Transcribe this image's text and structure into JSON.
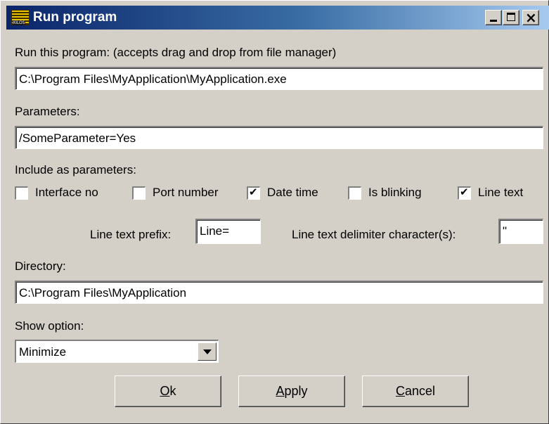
{
  "window": {
    "title": "Run program"
  },
  "run_program": {
    "label": "Run this program: (accepts drag and drop from file manager)",
    "value": "C:\\Program Files\\MyApplication\\MyApplication.exe"
  },
  "parameters": {
    "label": "Parameters:",
    "value": "/SomeParameter=Yes"
  },
  "include": {
    "label": "Include as parameters:",
    "options": [
      {
        "label": "Interface no",
        "checked": false
      },
      {
        "label": "Port number",
        "checked": false
      },
      {
        "label": "Date time",
        "checked": true
      },
      {
        "label": "Is blinking",
        "checked": false
      },
      {
        "label": "Line text",
        "checked": true
      }
    ]
  },
  "line_text": {
    "prefix_label": "Line text prefix:",
    "prefix_value": "Line=",
    "delimiter_label": "Line text delimiter character(s):",
    "delimiter_value": "\""
  },
  "directory": {
    "label": "Directory:",
    "value": "C:\\Program Files\\MyApplication"
  },
  "show_option": {
    "label": "Show option:",
    "selected": "Minimize"
  },
  "buttons": {
    "ok": {
      "mnemonic": "O",
      "rest": "k"
    },
    "apply": {
      "mnemonic": "A",
      "rest": "pply"
    },
    "cancel": {
      "mnemonic": "C",
      "rest": "ancel"
    }
  },
  "icons": {
    "app": "app-logo-icon",
    "minimize": "minimize-icon",
    "maximize": "maximize-icon",
    "close": "close-icon",
    "dropdown": "chevron-down-icon",
    "check": "checkmark-icon"
  },
  "colors": {
    "title_start": "#0a246a",
    "title_end": "#a6caf0",
    "face": "#d4d0c8"
  }
}
